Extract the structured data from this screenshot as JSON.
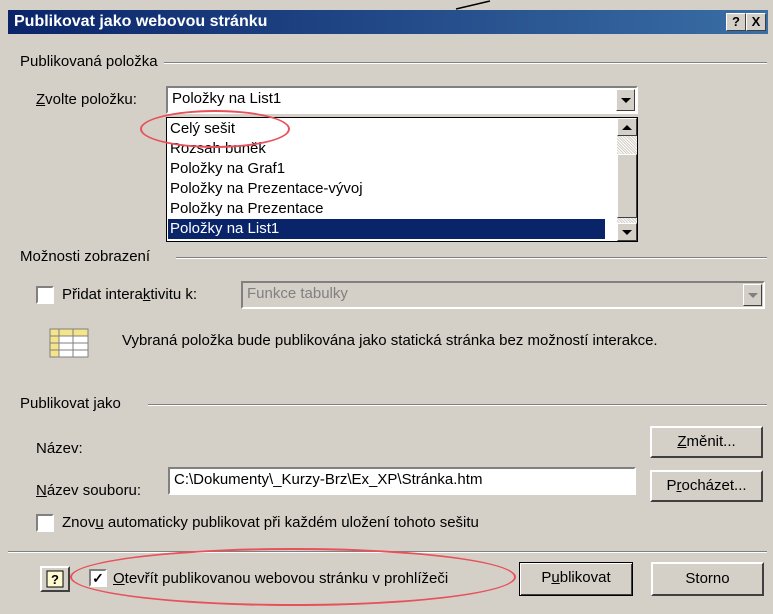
{
  "window": {
    "title": "Publikovat jako webovou stránku",
    "help_btn": "?",
    "close_btn": "X"
  },
  "published_item": {
    "group_label": "Publikovaná položka",
    "choose_label_underlined": "Z",
    "choose_label_rest": "volte položku:",
    "selected_value": "Položky na List1",
    "options": [
      "Celý sešit",
      "Rozsah buněk",
      "Položky na Graf1",
      "Položky na Prezentace-vývoj",
      "Položky na Prezentace",
      "Položky na List1"
    ],
    "highlighted_index": 5
  },
  "view_options": {
    "group_label": "Možnosti zobrazení",
    "interactivity_label_a": "Přidat intera",
    "interactivity_label_u": "k",
    "interactivity_label_b": "tivitu k:",
    "interactivity_checked": false,
    "interactivity_value": "Funkce tabulky",
    "info_text": "Vybraná položka bude publikována jako statická stránka bez možností interakce."
  },
  "publish_as": {
    "group_label": "Publikovat jako",
    "name_label": "Název:",
    "change_button_u": "Z",
    "change_button_rest": "měnit...",
    "filename_label_u": "N",
    "filename_label_rest": "ázev souboru:",
    "filename_value": "C:\\Dokumenty\\_Kurzy-Brz\\Ex_XP\\Stránka.htm",
    "browse_button_a": "P",
    "browse_button_u": "r",
    "browse_button_b": "ocházet...",
    "autorepublish_label_a": "Znov",
    "autorepublish_label_u": "u",
    "autorepublish_label_b": " automaticky publikovat při každém uložení tohoto sešitu",
    "autorepublish_checked": false
  },
  "footer": {
    "open_in_browser_label_u": "O",
    "open_in_browser_label_rest": "tevřít publikovanou webovou stránku v prohlížeči",
    "open_in_browser_checked": true,
    "publish_button_a": "P",
    "publish_button_u": "u",
    "publish_button_b": "blikovat",
    "cancel_button": "Storno",
    "check_mark": "✓"
  },
  "annotation_color": "#e8505a",
  "selection_color": "#0a246a"
}
